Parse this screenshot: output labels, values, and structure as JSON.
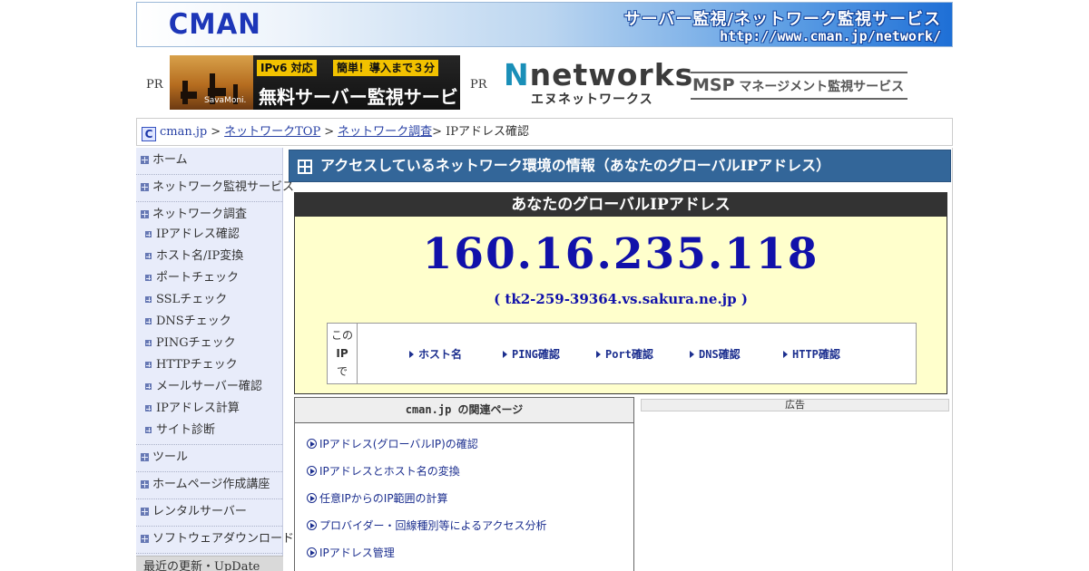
{
  "header": {
    "logo": "CMAN",
    "title": "サーバー監視/ネットワーク監視サービス",
    "url": "http://www.cman.jp/network/"
  },
  "ads": {
    "pr_label": "PR",
    "savamoni": {
      "tag1": "IPv6 対応",
      "tag2": "簡単！導入まで３分",
      "main": "無料サーバー監視サービス",
      "brand": "SavaMoni."
    },
    "nnetworks": {
      "logo_n": "N",
      "logo_rest": "networks",
      "sub": "エヌネットワークス"
    },
    "msp": {
      "big": "MSP",
      "text": "マネージメント監視サービス"
    }
  },
  "breadcrumb": {
    "icon": "C",
    "items": [
      "cman.jp",
      "ネットワークTOP",
      "ネットワーク調査"
    ],
    "current": "> IPアドレス確認"
  },
  "sidebar": {
    "items": [
      "ホーム",
      "ネットワーク監視サービス",
      "ネットワーク調査"
    ],
    "sub_items": [
      "IPアドレス確認",
      "ホスト名/IP変換",
      "ポートチェック",
      "SSLチェック",
      "DNSチェック",
      "PINGチェック",
      "HTTPチェック",
      "メールサーバー確認",
      "IPアドレス計算",
      "サイト診断"
    ],
    "items_after": [
      "ツール",
      "ホームページ作成講座",
      "レンタルサーバー",
      "ソフトウェアダウンロード"
    ],
    "bottom": "最近の更新・UpDate"
  },
  "content": {
    "title": "アクセスしているネットワーク環境の情報（あなたのグローバルIPアドレス）",
    "ip_box": {
      "heading": "あなたのグローバルIPアドレス",
      "ip": "160.16.235.118",
      "host": "( tk2-259-39364.vs.sakura.ne.jp )",
      "tools_label": [
        "この",
        "IP",
        "で"
      ],
      "tools": [
        "ホスト名",
        "PING確認",
        "Port確認",
        "DNS確認",
        "HTTP確認"
      ]
    },
    "panel": {
      "heading": "cman.jp の関連ページ",
      "items": [
        "IPアドレス(グローバルIP)の確認",
        "IPアドレスとホスト名の変換",
        "任意IPからのIP範囲の計算",
        "プロバイダー・回線種別等によるアクセス分析",
        "IPアドレス管理"
      ]
    },
    "ad_label": "広告"
  },
  "colors": {
    "title_bar": "#336699",
    "ip_box_bg": "#ffffcc",
    "ip_text": "#1111aa",
    "sidebar_bg": "#e8ecfa"
  }
}
